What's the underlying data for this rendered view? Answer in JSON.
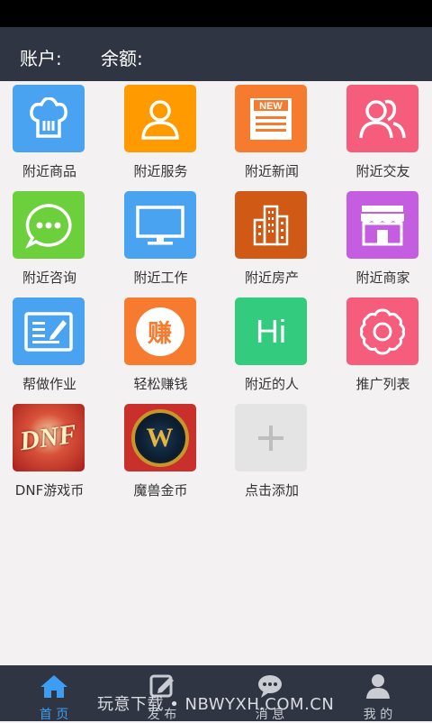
{
  "header": {
    "account_label": "账户:",
    "balance_label": "余额:"
  },
  "grid": [
    {
      "label": "附近商品",
      "icon": "chef-hat-icon",
      "color": "#4aa3f0"
    },
    {
      "label": "附近服务",
      "icon": "person-icon",
      "color": "#ff9a00"
    },
    {
      "label": "附近新闻",
      "icon": "newspaper-icon",
      "color": "#f77b2e",
      "badge": "NEW"
    },
    {
      "label": "附近交友",
      "icon": "people-icon",
      "color": "#f65d7c"
    },
    {
      "label": "附近咨询",
      "icon": "chat-bubble-icon",
      "color": "#6ccf3c"
    },
    {
      "label": "附近工作",
      "icon": "monitor-icon",
      "color": "#4aa3f0"
    },
    {
      "label": "附近房产",
      "icon": "building-icon",
      "color": "#d05a15"
    },
    {
      "label": "附近商家",
      "icon": "storefront-icon",
      "color": "#c45de0"
    },
    {
      "label": "帮做作业",
      "icon": "notebook-icon",
      "color": "#4aa3f0"
    },
    {
      "label": "轻松赚钱",
      "icon": "earn-icon",
      "color": "#f77b2e",
      "glyph": "赚"
    },
    {
      "label": "附近的人",
      "icon": "hi-icon",
      "color": "#33cc7f",
      "glyph": "Hi"
    },
    {
      "label": "推广列表",
      "icon": "flower-ring-icon",
      "color": "#f65d7c"
    },
    {
      "label": "DNF游戏币",
      "icon": "dnf-logo-icon",
      "color": "#d0342c",
      "glyph": "DNF"
    },
    {
      "label": "魔兽金币",
      "icon": "warcraft-logo-icon",
      "color": "#c9302c",
      "glyph": "W"
    },
    {
      "label": "点击添加",
      "icon": "plus-icon",
      "color": "#e4e4e4"
    }
  ],
  "tabs": [
    {
      "label": "首 页",
      "icon": "home-icon",
      "active": true
    },
    {
      "label": "发 布",
      "icon": "edit-icon",
      "active": false
    },
    {
      "label": "消 息",
      "icon": "message-icon",
      "active": false
    },
    {
      "label": "我 的",
      "icon": "user-icon",
      "active": false
    }
  ],
  "watermark": "玩意下载 • NBWYXH.COM.CN",
  "colors": {
    "header_bg": "#2f3543",
    "page_bg": "#f3f1f1",
    "active_tab": "#3d9df2"
  }
}
